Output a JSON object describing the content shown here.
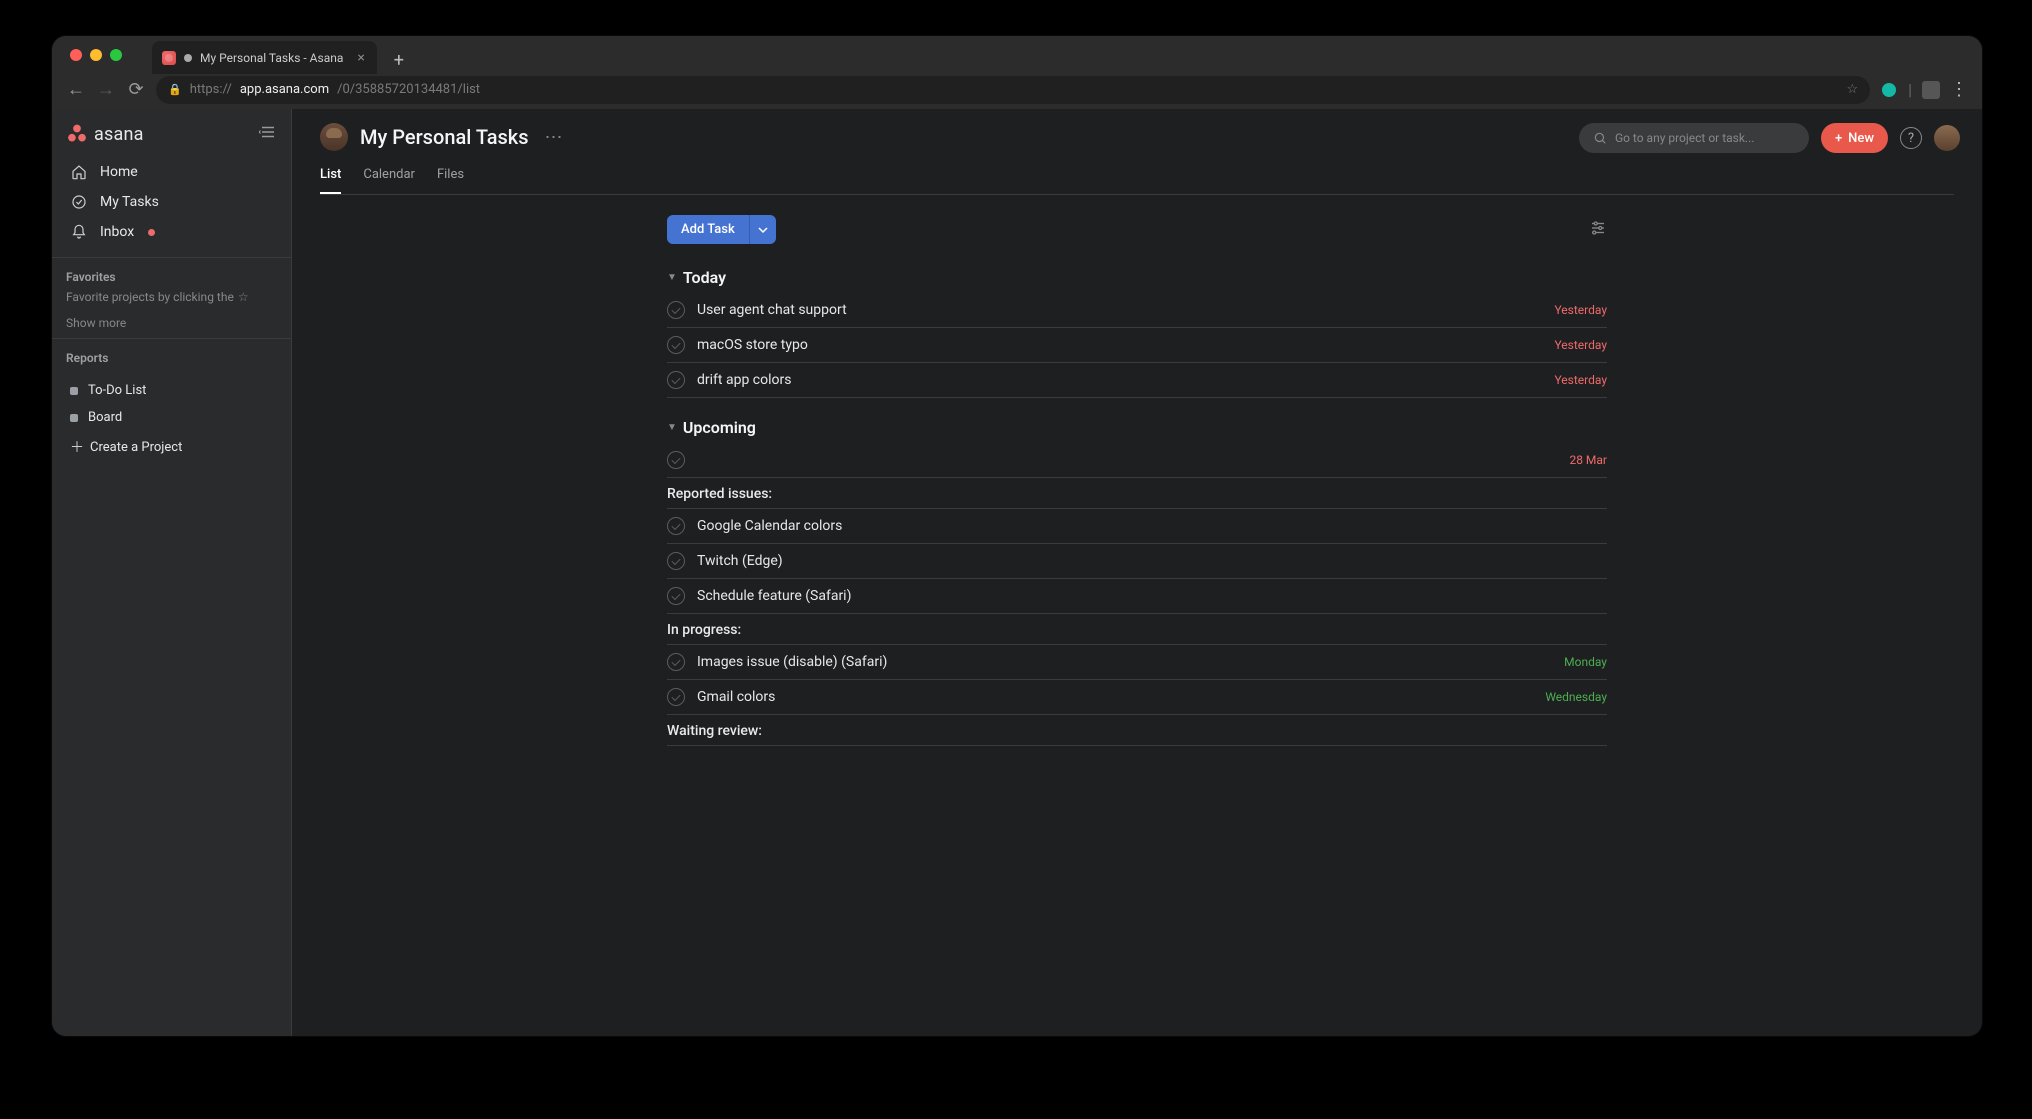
{
  "browser": {
    "tab_title": "My Personal Tasks - Asana",
    "url_prefix": "https://",
    "url_host": "app.asana.com",
    "url_path": "/0/35885720134481/list"
  },
  "sidebar": {
    "brand": "asana",
    "nav": {
      "home": "Home",
      "mytasks": "My Tasks",
      "inbox": "Inbox"
    },
    "favorites": {
      "title": "Favorites",
      "hint": "Favorite projects by clicking the",
      "showmore": "Show more"
    },
    "reports": {
      "title": "Reports",
      "todo": "To-Do List",
      "board": "Board",
      "create": "Create a Project"
    }
  },
  "header": {
    "title": "My Personal Tasks",
    "tabs": {
      "list": "List",
      "calendar": "Calendar",
      "files": "Files"
    },
    "search_placeholder": "Go to any project or task...",
    "new_btn": "New",
    "help": "?"
  },
  "toolbar": {
    "add_task": "Add Task"
  },
  "sections": [
    {
      "title": "Today",
      "rows": [
        {
          "name": "User agent chat support",
          "due": "Yesterday",
          "due_class": "past"
        },
        {
          "name": "macOS store typo",
          "due": "Yesterday",
          "due_class": "past"
        },
        {
          "name": "drift app colors",
          "due": "Yesterday",
          "due_class": "past"
        }
      ]
    },
    {
      "title": "Upcoming",
      "rows": [
        {
          "name": "",
          "due": "28 Mar",
          "due_class": "futwarn"
        }
      ],
      "subsections": [
        {
          "title": "Reported issues:",
          "rows": [
            {
              "name": "Google Calendar colors",
              "due": "",
              "due_class": ""
            },
            {
              "name": "Twitch (Edge)",
              "due": "",
              "due_class": ""
            },
            {
              "name": "Schedule feature (Safari)",
              "due": "",
              "due_class": ""
            }
          ]
        },
        {
          "title": "In progress:",
          "rows": [
            {
              "name": "Images issue (disable) (Safari)",
              "due": "Monday",
              "due_class": "norm"
            },
            {
              "name": "Gmail colors",
              "due": "Wednesday",
              "due_class": "norm"
            }
          ]
        },
        {
          "title": "Waiting review:",
          "rows": []
        }
      ]
    }
  ]
}
